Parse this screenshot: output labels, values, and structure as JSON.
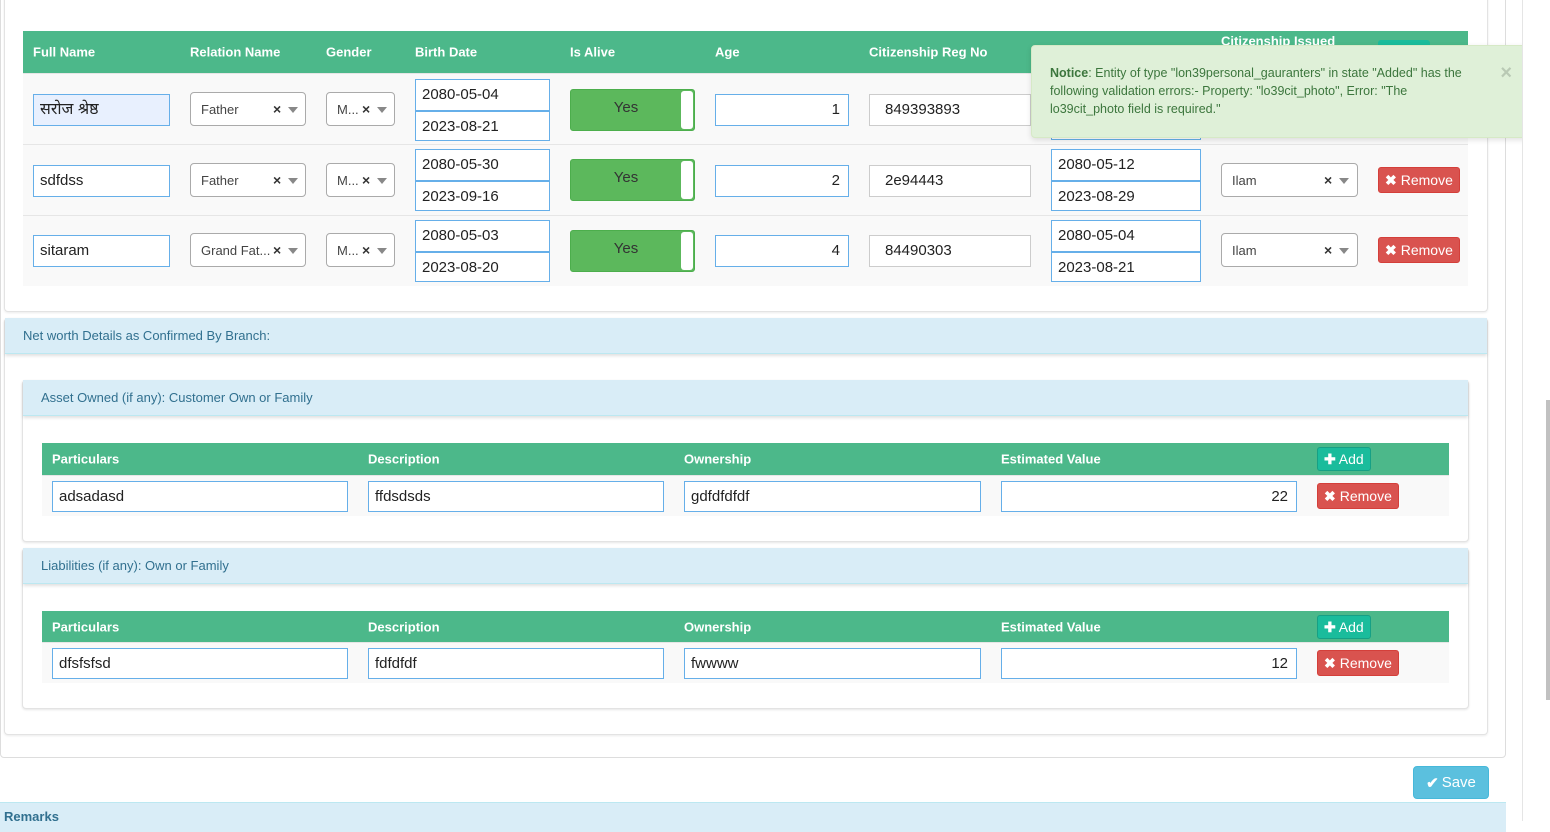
{
  "guarantors": {
    "headers": {
      "full_name": "Full Name",
      "relation_name": "Relation Name",
      "gender": "Gender",
      "birth_date": "Birth Date",
      "is_alive": "Is Alive",
      "age": "Age",
      "citizenship_reg_no": "Citizenship Reg No",
      "citizenship_issued": "Citizenship Issued"
    },
    "rows": [
      {
        "full_name": "सरोज श्रेष्ठ",
        "relation": "Father",
        "gender": "M...",
        "birth_bs": "2080-05-04",
        "birth_ad": "2023-08-21",
        "is_alive": "Yes",
        "age": "1",
        "cit_reg_no": "849393893"
      },
      {
        "full_name": "sdfdss",
        "relation": "Father",
        "gender": "M...",
        "birth_bs": "2080-05-30",
        "birth_ad": "2023-09-16",
        "is_alive": "Yes",
        "age": "2",
        "cit_reg_no": "2e94443",
        "issued_bs": "2080-05-12",
        "issued_ad": "2023-08-29",
        "issued_district": "Ilam",
        "remove": "Remove"
      },
      {
        "full_name": "sitaram",
        "relation": "Grand Fat...",
        "gender": "M...",
        "birth_bs": "2080-05-03",
        "birth_ad": "2023-08-20",
        "is_alive": "Yes",
        "age": "4",
        "cit_reg_no": "84490303",
        "issued_bs": "2080-05-04",
        "issued_ad": "2023-08-21",
        "issued_district": "Ilam",
        "remove": "Remove"
      }
    ]
  },
  "notice": {
    "title": "Notice",
    "message": ": Entity of type \"lon39personal_gauranters\" in state \"Added\" has the following validation errors:- Property: \"lo39cit_photo\", Error: \"The lo39cit_photo field is required.\"",
    "close": "×"
  },
  "networth": {
    "heading": "Net worth Details as Confirmed By Branch:",
    "assets": {
      "heading": "Asset Owned (if any): Customer Own or Family",
      "headers": {
        "particulars": "Particulars",
        "description": "Description",
        "ownership": "Ownership",
        "estimated_value": "Estimated Value"
      },
      "add": "Add",
      "rows": [
        {
          "particulars": "adsadasd",
          "description": "ffdsdsds",
          "ownership": "gdfdfdfdf",
          "estimated_value": "22",
          "remove": "Remove"
        }
      ]
    },
    "liabilities": {
      "heading": "Liabilities (if any): Own or Family",
      "headers": {
        "particulars": "Particulars",
        "description": "Description",
        "ownership": "Ownership",
        "estimated_value": "Estimated Value"
      },
      "add": "Add",
      "rows": [
        {
          "particulars": "dfsfsfsd",
          "description": "fdfdfdf",
          "ownership": "fwwww",
          "estimated_value": "12",
          "remove": "Remove"
        }
      ]
    }
  },
  "save_label": "Save",
  "remarks_label": "Remarks",
  "colors": {
    "table_header": "#4cb88a",
    "toggle_on": "#5cb85c",
    "remove": "#d9534f",
    "add": "#1abc9c",
    "save": "#5bc0de",
    "notice_bg": "#dff0d8",
    "panel_heading": "#d9edf7"
  }
}
